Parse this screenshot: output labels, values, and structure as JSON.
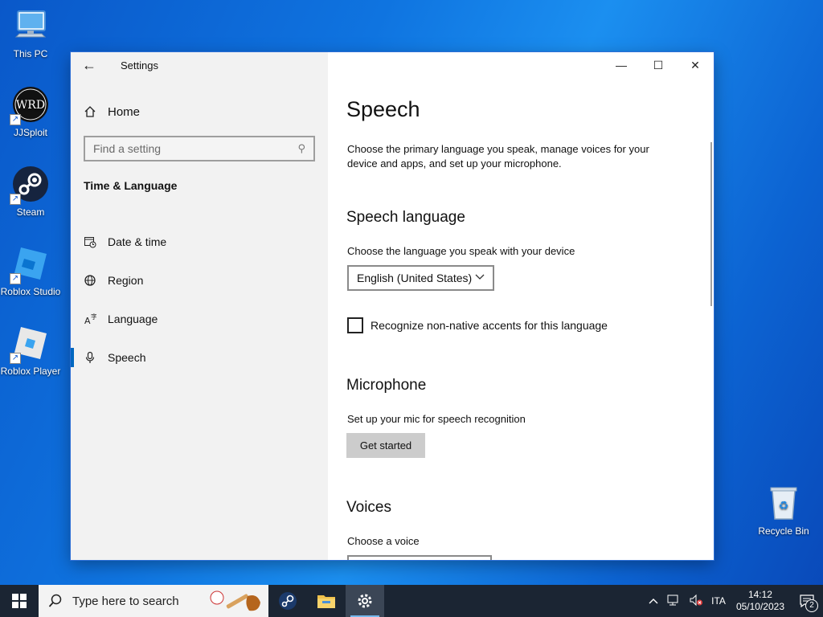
{
  "desktop": {
    "icons": [
      {
        "label": "This PC",
        "icon": "computer-icon"
      },
      {
        "label": "JJSploit",
        "icon": "jjsploit-icon"
      },
      {
        "label": "Steam",
        "icon": "steam-icon"
      },
      {
        "label": "Roblox Studio",
        "icon": "roblox-studio-icon"
      },
      {
        "label": "Roblox Player",
        "icon": "roblox-player-icon"
      },
      {
        "label": "Recycle Bin",
        "icon": "recycle-bin-icon"
      }
    ],
    "jjsploit_logo_text": "WRD"
  },
  "window": {
    "app_title": "Settings",
    "back_icon": "←",
    "controls": {
      "minimize": "—",
      "maximize": "☐",
      "close": "✕"
    }
  },
  "sidebar": {
    "home_label": "Home",
    "search_placeholder": "Find a setting",
    "section_title": "Time & Language",
    "items": [
      {
        "label": "Date & time",
        "icon": "calendar-clock-icon",
        "glyph": "▦"
      },
      {
        "label": "Region",
        "icon": "globe-icon",
        "glyph": "◎"
      },
      {
        "label": "Language",
        "icon": "language-icon",
        "glyph": "A⁺"
      },
      {
        "label": "Speech",
        "icon": "microphone-icon",
        "glyph": "🎙︎",
        "active": true
      }
    ]
  },
  "content": {
    "title": "Speech",
    "description": "Choose the primary language you speak, manage voices for your device and apps, and set up your microphone.",
    "speech_language": {
      "heading": "Speech language",
      "label": "Choose the language you speak with your device",
      "selected": "English (United States)",
      "checkbox_label": "Recognize non-native accents for this language",
      "checkbox_checked": false
    },
    "microphone": {
      "heading": "Microphone",
      "label": "Set up your mic for speech recognition",
      "button": "Get started"
    },
    "voices": {
      "heading": "Voices",
      "label": "Choose a voice"
    }
  },
  "taskbar": {
    "search_placeholder": "Type here to search",
    "apps": [
      "steam-icon",
      "file-explorer-icon",
      "settings-icon"
    ],
    "tray": {
      "language": "ITA",
      "time": "14:12",
      "date": "05/10/2023",
      "notification_count": "2"
    }
  },
  "colors": {
    "accent": "#0067c0",
    "taskbar": "#1b2533",
    "desktop": "#0f74e0"
  }
}
